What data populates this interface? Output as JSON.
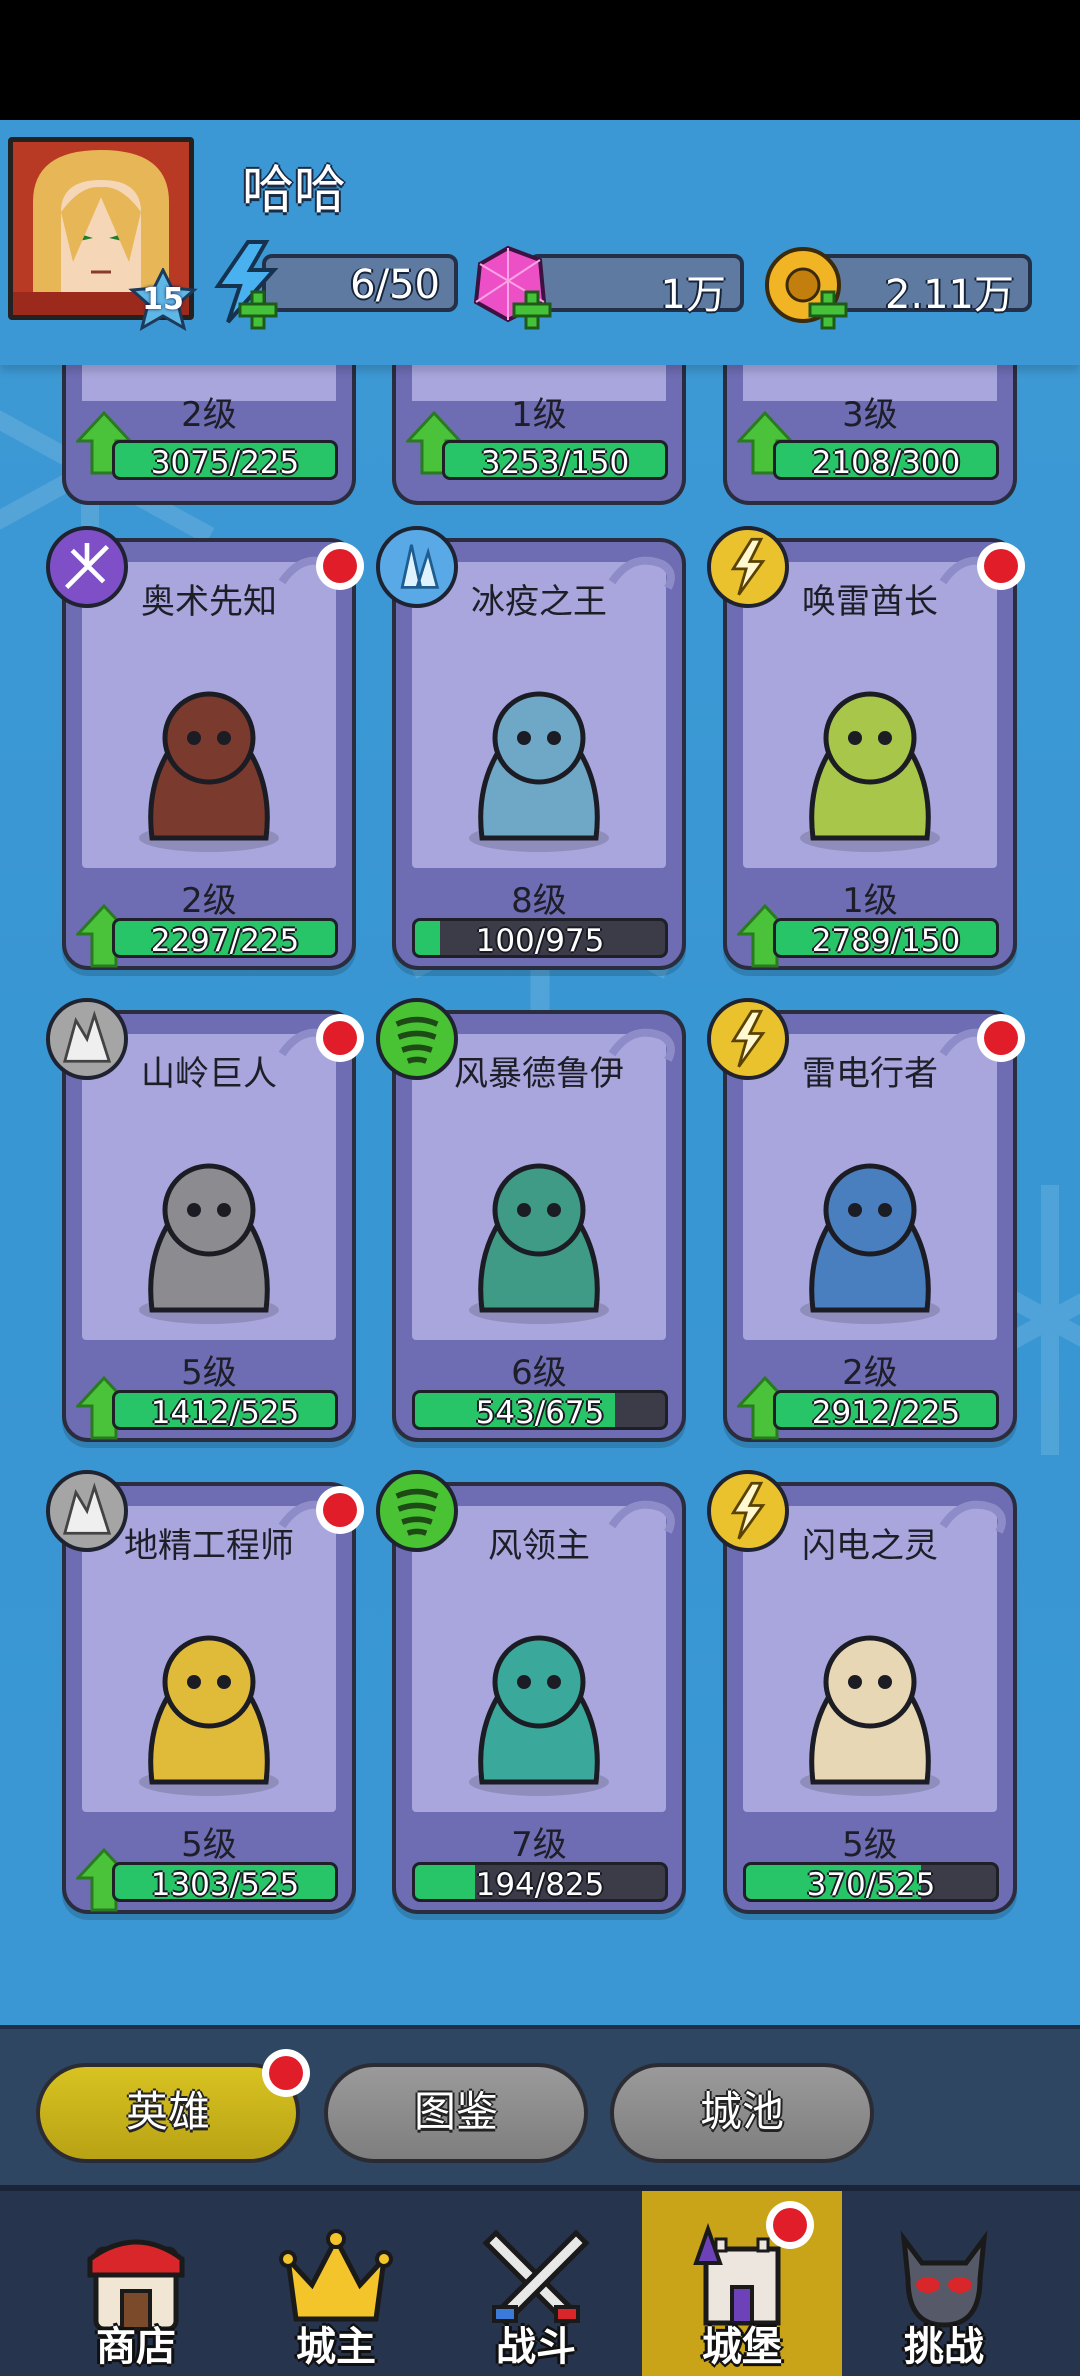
{
  "player": {
    "name": "哈哈",
    "level": "15"
  },
  "resources": {
    "energy": "6/50",
    "gems": "1万",
    "gold": "2.11万"
  },
  "top_row": [
    {
      "level": "2级",
      "xp": "3075/225"
    },
    {
      "level": "1级",
      "xp": "3253/150"
    },
    {
      "level": "3级",
      "xp": "2108/300"
    }
  ],
  "heroes": [
    {
      "name": "奥术先知",
      "level": "2级",
      "xp": "2297/225",
      "progress": 1.0
    },
    {
      "name": "冰疫之王",
      "level": "8级",
      "xp": "100/975",
      "progress": 0.1
    },
    {
      "name": "唤雷酋长",
      "level": "1级",
      "xp": "2789/150",
      "progress": 1.0
    },
    {
      "name": "山岭巨人",
      "level": "5级",
      "xp": "1412/525",
      "progress": 1.0
    },
    {
      "name": "风暴德鲁伊",
      "level": "6级",
      "xp": "543/675",
      "progress": 0.8
    },
    {
      "name": "雷电行者",
      "level": "2级",
      "xp": "2912/225",
      "progress": 1.0
    },
    {
      "name": "地精工程师",
      "level": "5级",
      "xp": "1303/525",
      "progress": 1.0
    },
    {
      "name": "风领主",
      "level": "7级",
      "xp": "194/825",
      "progress": 0.24
    },
    {
      "name": "闪电之灵",
      "level": "5级",
      "xp": "370/525",
      "progress": 0.7
    }
  ],
  "tabs": {
    "heroes": "英雄",
    "codex": "图鉴",
    "city": "城池"
  },
  "nav": {
    "shop": "商店",
    "lord": "城主",
    "battle": "战斗",
    "castle": "城堡",
    "challenge": "挑战"
  },
  "colors": {
    "xp_green": "#27c468",
    "card_purple": "#6e6cb3",
    "active_tab": "#d8c322",
    "notification_red": "#e21d2a"
  }
}
